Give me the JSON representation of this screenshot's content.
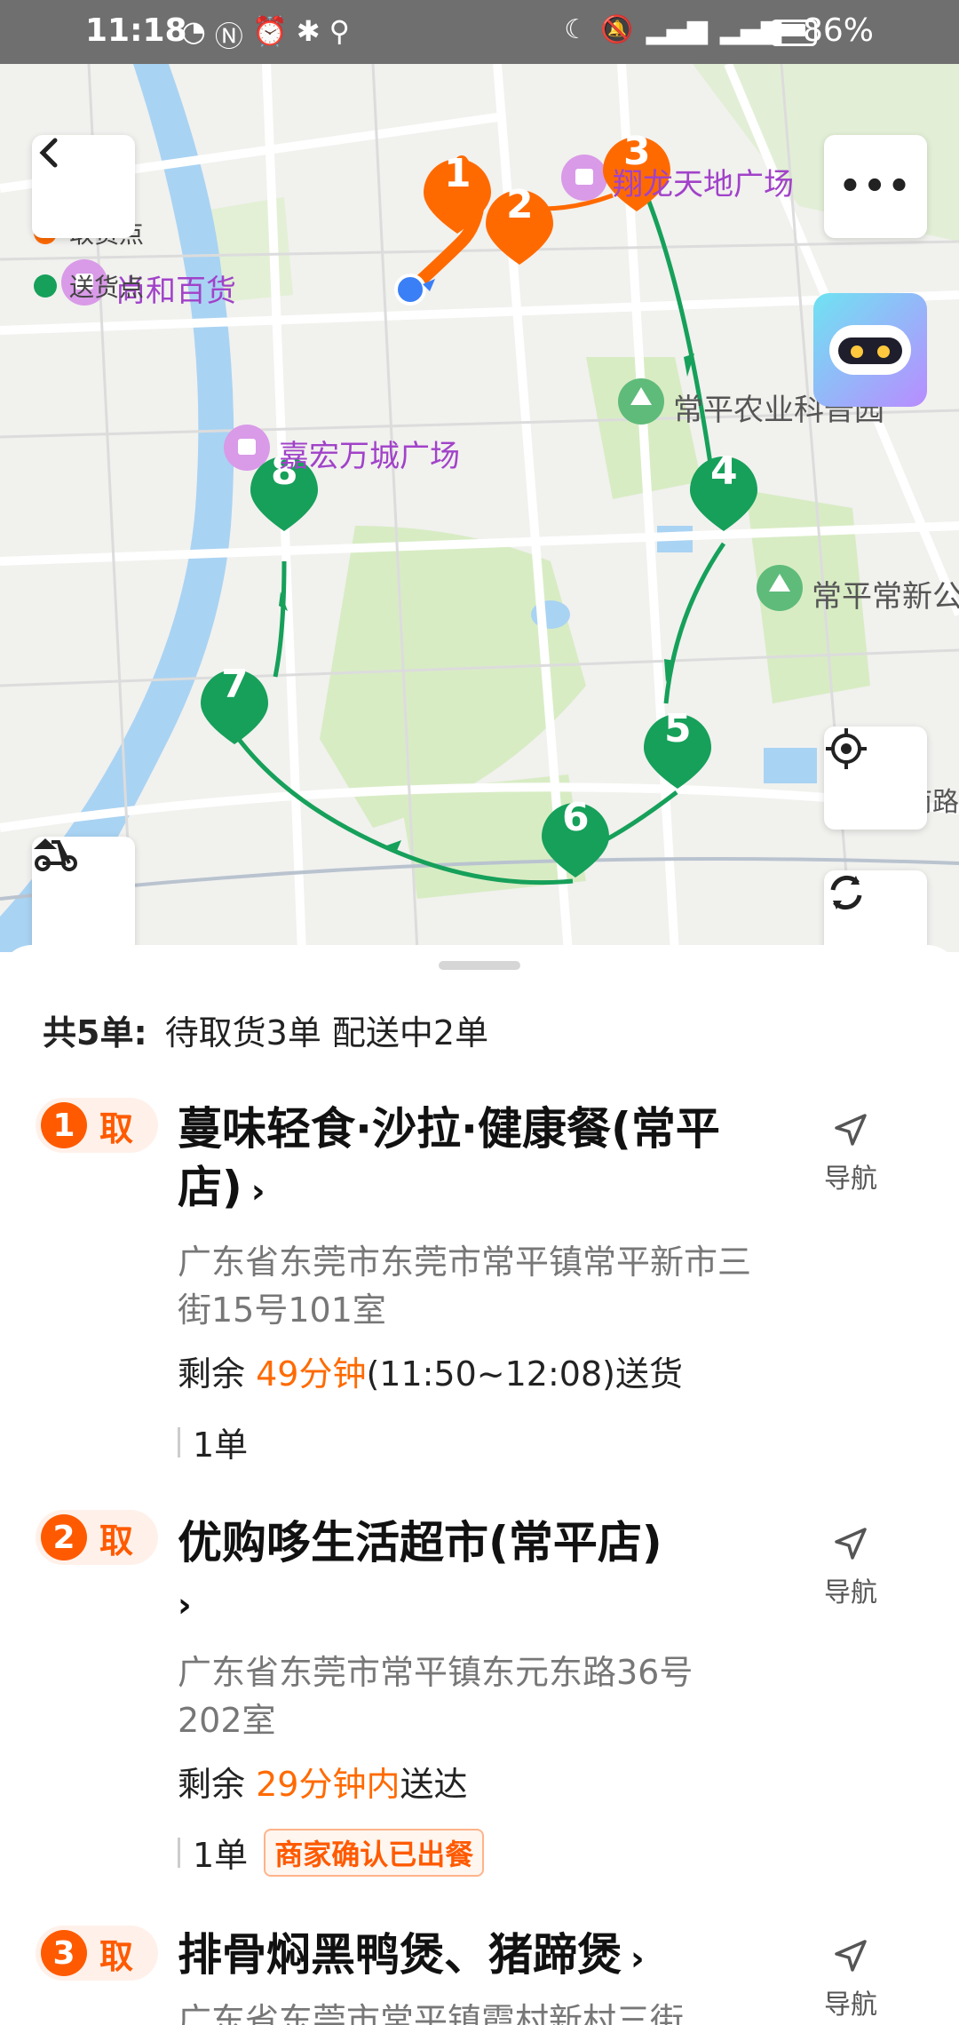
{
  "status_bar": {
    "time": "11:18",
    "battery": "86%"
  },
  "map": {
    "legend": [
      {
        "label": "取货点",
        "color": "#ff6a00"
      },
      {
        "label": "送货点",
        "color": "#16a05a"
      }
    ],
    "pois": [
      {
        "name": "翔龙天地广场",
        "kind": "shopping"
      },
      {
        "name": "尚和百货",
        "kind": "shopping"
      },
      {
        "name": "嘉宏万城广场",
        "kind": "shopping"
      },
      {
        "name": "常平农业科普园",
        "kind": "park"
      },
      {
        "name": "常平常新公",
        "kind": "park"
      },
      {
        "name": "常南路",
        "kind": "road"
      }
    ],
    "markers": {
      "pickup": [
        "1",
        "2",
        "3"
      ],
      "delivery": [
        "4",
        "5",
        "6",
        "7",
        "8"
      ]
    },
    "colors": {
      "pickup": "#ff6a00",
      "delivery": "#16a05a",
      "my_location": "#3a7ff6"
    }
  },
  "sheet": {
    "summary_lead": "共5单:",
    "summary_detail": "待取货3单 配送中2单",
    "nav_label": "导航",
    "orders": [
      {
        "index": "1",
        "action": "取",
        "store": "蔓味轻食·沙拉·健康餐(常平店)",
        "address": "广东省东莞市东莞市常平镇常平新市三街15号101室",
        "time_prefix": "剩余 ",
        "time_highlight": "49分钟",
        "time_suffix": "(11:50~12:08)送货",
        "count": "1单",
        "badge": ""
      },
      {
        "index": "2",
        "action": "取",
        "store": "优购哆生活超市(常平店)",
        "address": "广东省东莞市常平镇东元东路36号202室",
        "time_prefix": "剩余 ",
        "time_highlight": "29分钟内",
        "time_suffix": "送达",
        "count": "1单",
        "badge": "商家确认已出餐"
      },
      {
        "index": "3",
        "action": "取",
        "store": "排骨焖黑鸭煲、猪蹄煲",
        "address": "广东省东莞市常平镇霞村新村三街"
      }
    ]
  }
}
